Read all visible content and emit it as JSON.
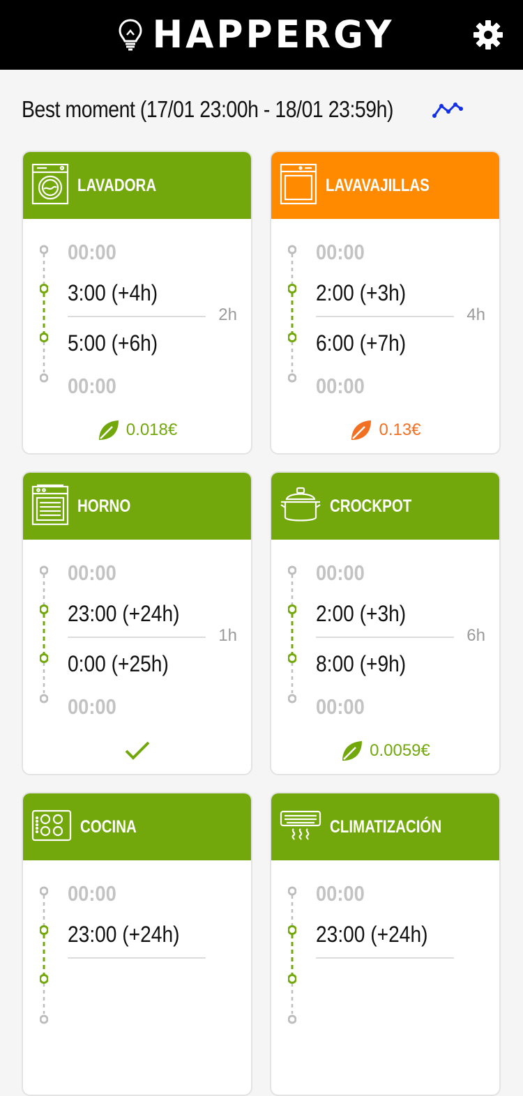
{
  "app": {
    "name": "HAPPERGY"
  },
  "headline": {
    "text": "Best moment (17/01 23:00h - 18/01 23:59h)"
  },
  "colors": {
    "green": "#72a80c",
    "orange": "#ff8a00",
    "cost_orange": "#f36f21",
    "muted": "#c3c3c3",
    "trend": "#1430e6"
  },
  "cards": [
    {
      "title": "LAVADORA",
      "icon": "washing-machine-icon",
      "header_color": "#72a80c",
      "slot_before": "00:00",
      "start": "3:00 (+4h)",
      "end": "5:00 (+6h)",
      "slot_after": "00:00",
      "duration": "2h",
      "cost": "0.018€",
      "cost_color": "#72a80c",
      "status": "cost"
    },
    {
      "title": "LAVAVAJILLAS",
      "icon": "dishwasher-icon",
      "header_color": "#ff8a00",
      "slot_before": "00:00",
      "start": "2:00 (+3h)",
      "end": "6:00 (+7h)",
      "slot_after": "00:00",
      "duration": "4h",
      "cost": "0.13€",
      "cost_color": "#f36f21",
      "status": "cost"
    },
    {
      "title": "HORNO",
      "icon": "oven-icon",
      "header_color": "#72a80c",
      "slot_before": "00:00",
      "start": "23:00 (+24h)",
      "end": "0:00 (+25h)",
      "slot_after": "00:00",
      "duration": "1h",
      "cost": "",
      "cost_color": "#72a80c",
      "status": "check"
    },
    {
      "title": "CROCKPOT",
      "icon": "crockpot-icon",
      "header_color": "#72a80c",
      "slot_before": "00:00",
      "start": "2:00 (+3h)",
      "end": "8:00 (+9h)",
      "slot_after": "00:00",
      "duration": "6h",
      "cost": "0.0059€",
      "cost_color": "#72a80c",
      "status": "cost"
    },
    {
      "title": "COCINA",
      "icon": "cooktop-icon",
      "header_color": "#72a80c",
      "slot_before": "00:00",
      "start": "23:00 (+24h)",
      "end": "",
      "slot_after": "",
      "duration": "",
      "cost": "",
      "cost_color": "#72a80c",
      "status": ""
    },
    {
      "title": "CLIMATIZACIÓN",
      "icon": "air-conditioner-icon",
      "header_color": "#72a80c",
      "slot_before": "00:00",
      "start": "23:00 (+24h)",
      "end": "",
      "slot_after": "",
      "duration": "",
      "cost": "",
      "cost_color": "#72a80c",
      "status": ""
    }
  ]
}
